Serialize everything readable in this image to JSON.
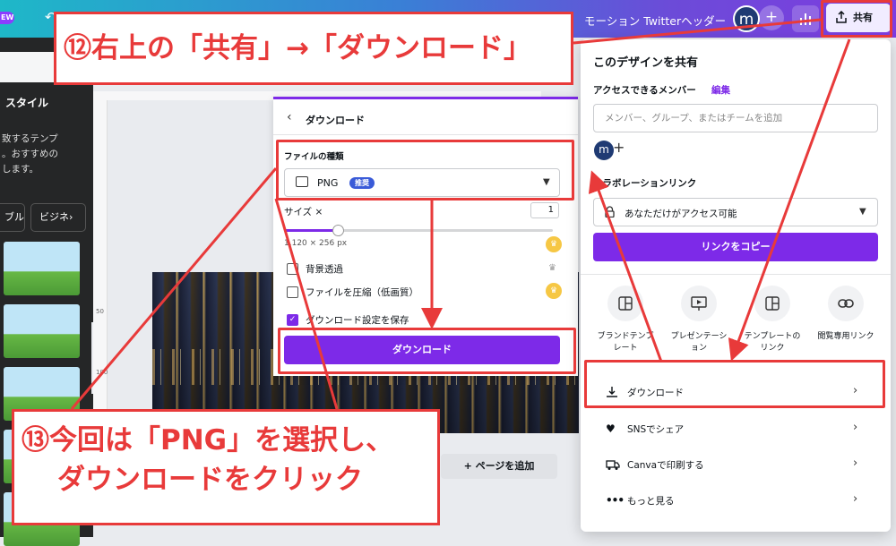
{
  "topbar": {
    "new_badge": "EW",
    "doc_title": "モーション Twitterヘッダー",
    "avatar_initial": "m",
    "share_label": "共有"
  },
  "sidebar": {
    "heading": "スタイル",
    "desc_lines": [
      "致するテンプ",
      "。おすすめの",
      "します。"
    ],
    "btn1": "ブル",
    "btn2": "ビジネ"
  },
  "canvas": {
    "ruler_marks": [
      "50",
      "100"
    ],
    "add_page": "+ ページを追加"
  },
  "download_panel": {
    "title": "ダウンロード",
    "file_type_label": "ファイルの種類",
    "file_type_value": "PNG",
    "file_type_badge": "推奨",
    "size_label": "サイズ ×",
    "size_value": "1",
    "size_fraction": 0.2,
    "dimensions": "1,120 × 256 px",
    "options": [
      {
        "label": "背景透過",
        "checked": false
      },
      {
        "label": "ファイルを圧縮（低画質）",
        "checked": false
      },
      {
        "label": "ダウンロード設定を保存",
        "checked": true
      }
    ],
    "download_button": "ダウンロード"
  },
  "share_panel": {
    "title": "このデザインを共有",
    "access_label": "アクセスできるメンバー",
    "edit_link": "編集",
    "member_placeholder": "メンバー、グループ、またはチームを追加",
    "avatar_initial": "m",
    "collab_label": "コラボレーションリンク",
    "collab_value": "あなただけがアクセス可能",
    "copy_link_button": "リンクをコピー",
    "options": [
      {
        "label_lines": [
          "ブランドテンプ",
          "レート"
        ],
        "icon": "layout-icon"
      },
      {
        "label_lines": [
          "プレゼンテーシ",
          "ョン"
        ],
        "icon": "presentation-icon"
      },
      {
        "label_lines": [
          "テンプレートの",
          "リンク"
        ],
        "icon": "template-link-icon"
      },
      {
        "label_lines": [
          "閲覧専用リンク"
        ],
        "icon": "link-icon"
      }
    ],
    "rows": [
      {
        "label": "ダウンロード",
        "icon": "download-icon"
      },
      {
        "label": "SNSでシェア",
        "icon": "heart-icon"
      },
      {
        "label": "Canvaで印刷する",
        "icon": "truck-icon"
      },
      {
        "label": "もっと見る",
        "icon": "more-icon"
      }
    ]
  },
  "annotations": {
    "step12": "⑫右上の「共有」→「ダウンロード」",
    "step13_line1": "⑬今回は「PNG」を選択し、",
    "step13_line2": "ダウンロードをクリック"
  },
  "colors": {
    "accent": "#7d2ae8",
    "annotation_red": "#e83a3a",
    "badge_blue": "#3a5bd8",
    "sidebar_bg": "#252627"
  }
}
